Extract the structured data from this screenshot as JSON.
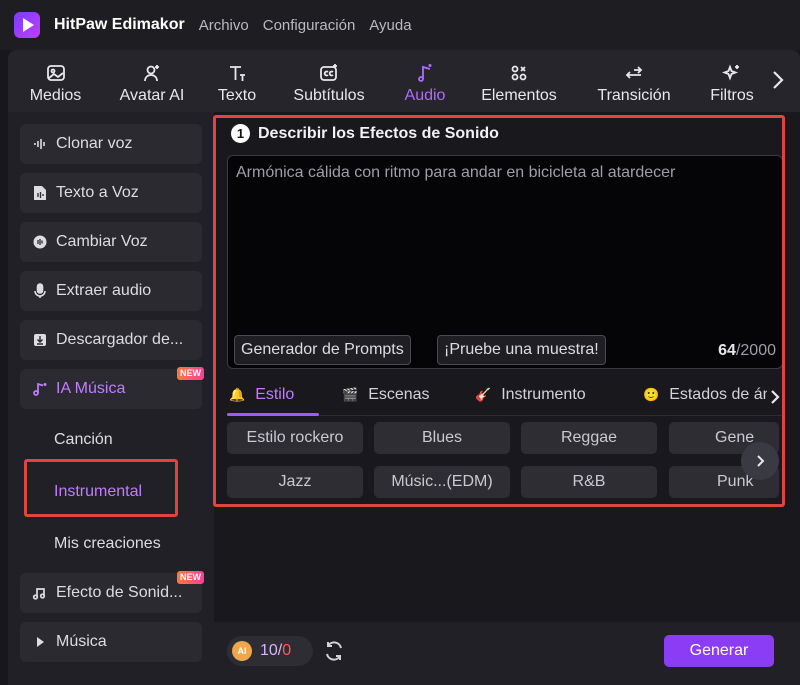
{
  "titlebar": {
    "app_name": "HitPaw Edimakor",
    "menu": [
      "Archivo",
      "Configuración",
      "Ayuda"
    ]
  },
  "toolbar": {
    "tabs": [
      {
        "label": "Medios",
        "icon": "media-icon"
      },
      {
        "label": "Avatar AI",
        "icon": "avatar-icon"
      },
      {
        "label": "Texto",
        "icon": "text-icon"
      },
      {
        "label": "Subtítulos",
        "icon": "subtitles-icon"
      },
      {
        "label": "Audio",
        "icon": "audio-icon",
        "active": true
      },
      {
        "label": "Elementos",
        "icon": "elements-icon"
      },
      {
        "label": "Transición",
        "icon": "transition-icon"
      },
      {
        "label": "Filtros",
        "icon": "filters-icon"
      }
    ],
    "accent_color": "#b06bff"
  },
  "sidebar": {
    "items": [
      {
        "label": "Clonar voz",
        "icon": "waveform-icon"
      },
      {
        "label": "Texto a Voz",
        "icon": "document-audio-icon"
      },
      {
        "label": "Cambiar Voz",
        "icon": "voice-change-icon"
      },
      {
        "label": "Extraer audio",
        "icon": "microphone-icon"
      },
      {
        "label": "Descargador de...",
        "icon": "download-icon"
      },
      {
        "label": "IA Música",
        "icon": "ai-music-icon",
        "active": true,
        "badge": "NEW"
      },
      {
        "label": "Efecto de Sonid...",
        "icon": "sound-effect-icon",
        "badge": "NEW"
      },
      {
        "label": "Música",
        "icon": "triangle-right-icon"
      }
    ],
    "sub_items": [
      {
        "label": "Canción"
      },
      {
        "label": "Instrumental",
        "active": true
      },
      {
        "label": "Mis creaciones"
      }
    ]
  },
  "main": {
    "step_number": "1",
    "title": "Describir los Efectos de Sonido",
    "prompt_text": "Armónica cálida con ritmo para andar en bicicleta al atardecer",
    "prompt_generator_label": "Generador de Prompts",
    "sample_label": "¡Pruebe una muestra!",
    "char_count": "64",
    "char_limit": "/2000",
    "tabs": [
      {
        "label": "Estilo",
        "icon": "bell-icon",
        "active": true
      },
      {
        "label": "Escenas",
        "icon": "clapper-icon"
      },
      {
        "label": "Instrumento",
        "icon": "guitar-icon"
      },
      {
        "label": "Estados de án",
        "icon": "smiley-icon"
      }
    ],
    "genres_row1": [
      "Estilo rockero",
      "Blues",
      "Reggae",
      "Gene"
    ],
    "genres_row2": [
      "Jazz",
      "Músic...(EDM)",
      "R&B",
      "Punk"
    ]
  },
  "bottom": {
    "coin_label": "AI",
    "credits_used": "10",
    "credits_sep": "/",
    "credits_total": "0",
    "generate_label": "Generar",
    "generate_color": "#8a3df5"
  }
}
